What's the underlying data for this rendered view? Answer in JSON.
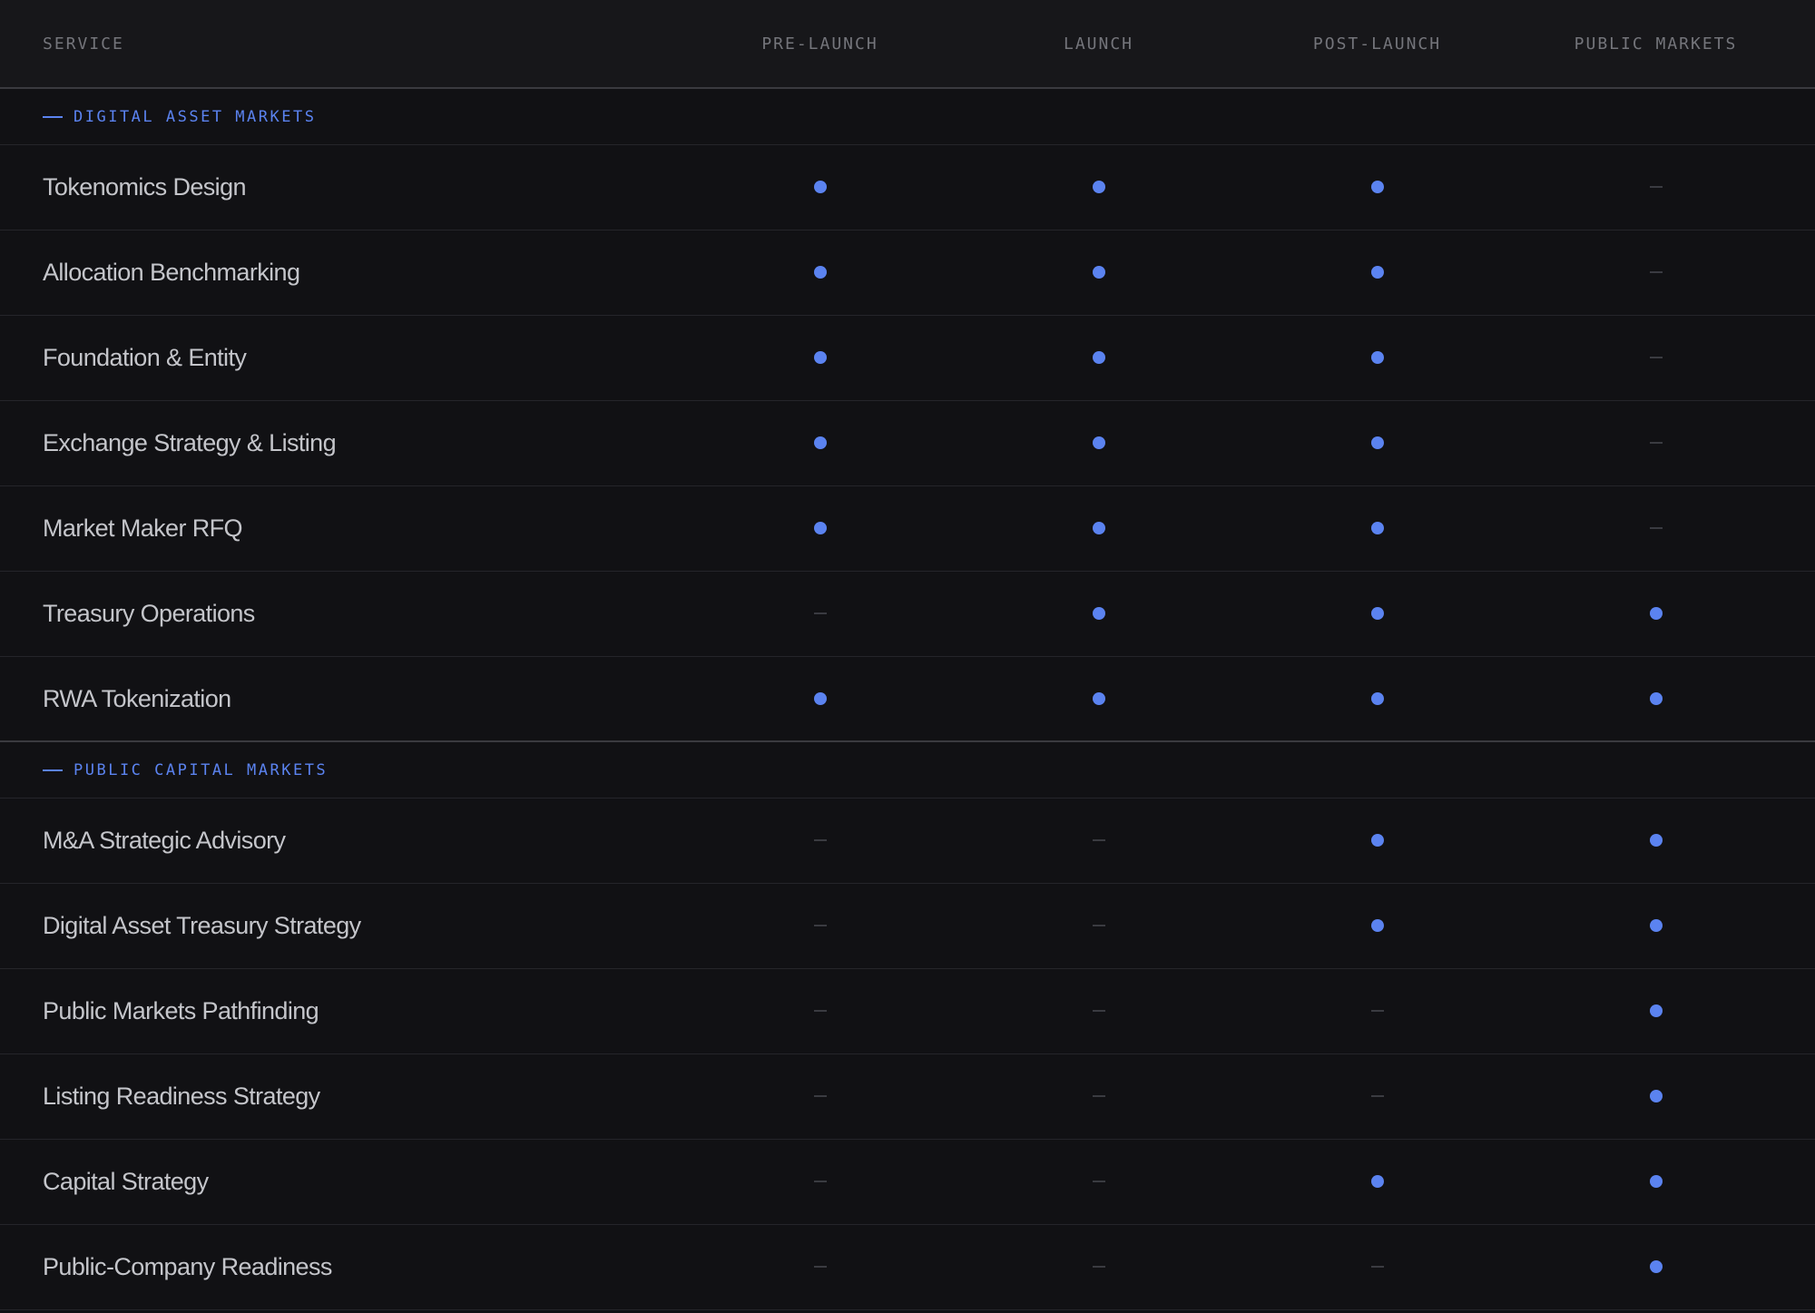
{
  "header": {
    "service": "SERVICE",
    "columns": [
      "PRE-LAUNCH",
      "LAUNCH",
      "POST-LAUNCH",
      "PUBLIC MARKETS"
    ]
  },
  "colors": {
    "accent": "#5b83f0",
    "background": "#111114",
    "header_bg": "#17171a",
    "dash": "#3a3b41"
  },
  "icons": {
    "available": "dot-icon",
    "not_available": "dash-icon"
  },
  "sections": [
    {
      "label": "DIGITAL ASSET MARKETS",
      "rows": [
        {
          "name": "Tokenomics Design",
          "marks": [
            true,
            true,
            true,
            false
          ]
        },
        {
          "name": "Allocation Benchmarking",
          "marks": [
            true,
            true,
            true,
            false
          ]
        },
        {
          "name": "Foundation & Entity",
          "marks": [
            true,
            true,
            true,
            false
          ]
        },
        {
          "name": "Exchange Strategy & Listing",
          "marks": [
            true,
            true,
            true,
            false
          ]
        },
        {
          "name": "Market Maker RFQ",
          "marks": [
            true,
            true,
            true,
            false
          ]
        },
        {
          "name": "Treasury Operations",
          "marks": [
            false,
            true,
            true,
            true
          ]
        },
        {
          "name": "RWA Tokenization",
          "marks": [
            true,
            true,
            true,
            true
          ]
        }
      ]
    },
    {
      "label": "PUBLIC CAPITAL MARKETS",
      "rows": [
        {
          "name": "M&A Strategic Advisory",
          "marks": [
            false,
            false,
            true,
            true
          ]
        },
        {
          "name": "Digital Asset Treasury Strategy",
          "marks": [
            false,
            false,
            true,
            true
          ]
        },
        {
          "name": "Public Markets Pathfinding",
          "marks": [
            false,
            false,
            false,
            true
          ]
        },
        {
          "name": "Listing Readiness Strategy",
          "marks": [
            false,
            false,
            false,
            true
          ]
        },
        {
          "name": "Capital Strategy",
          "marks": [
            false,
            false,
            true,
            true
          ]
        },
        {
          "name": "Public-Company Readiness",
          "marks": [
            false,
            false,
            false,
            true
          ]
        }
      ]
    }
  ]
}
